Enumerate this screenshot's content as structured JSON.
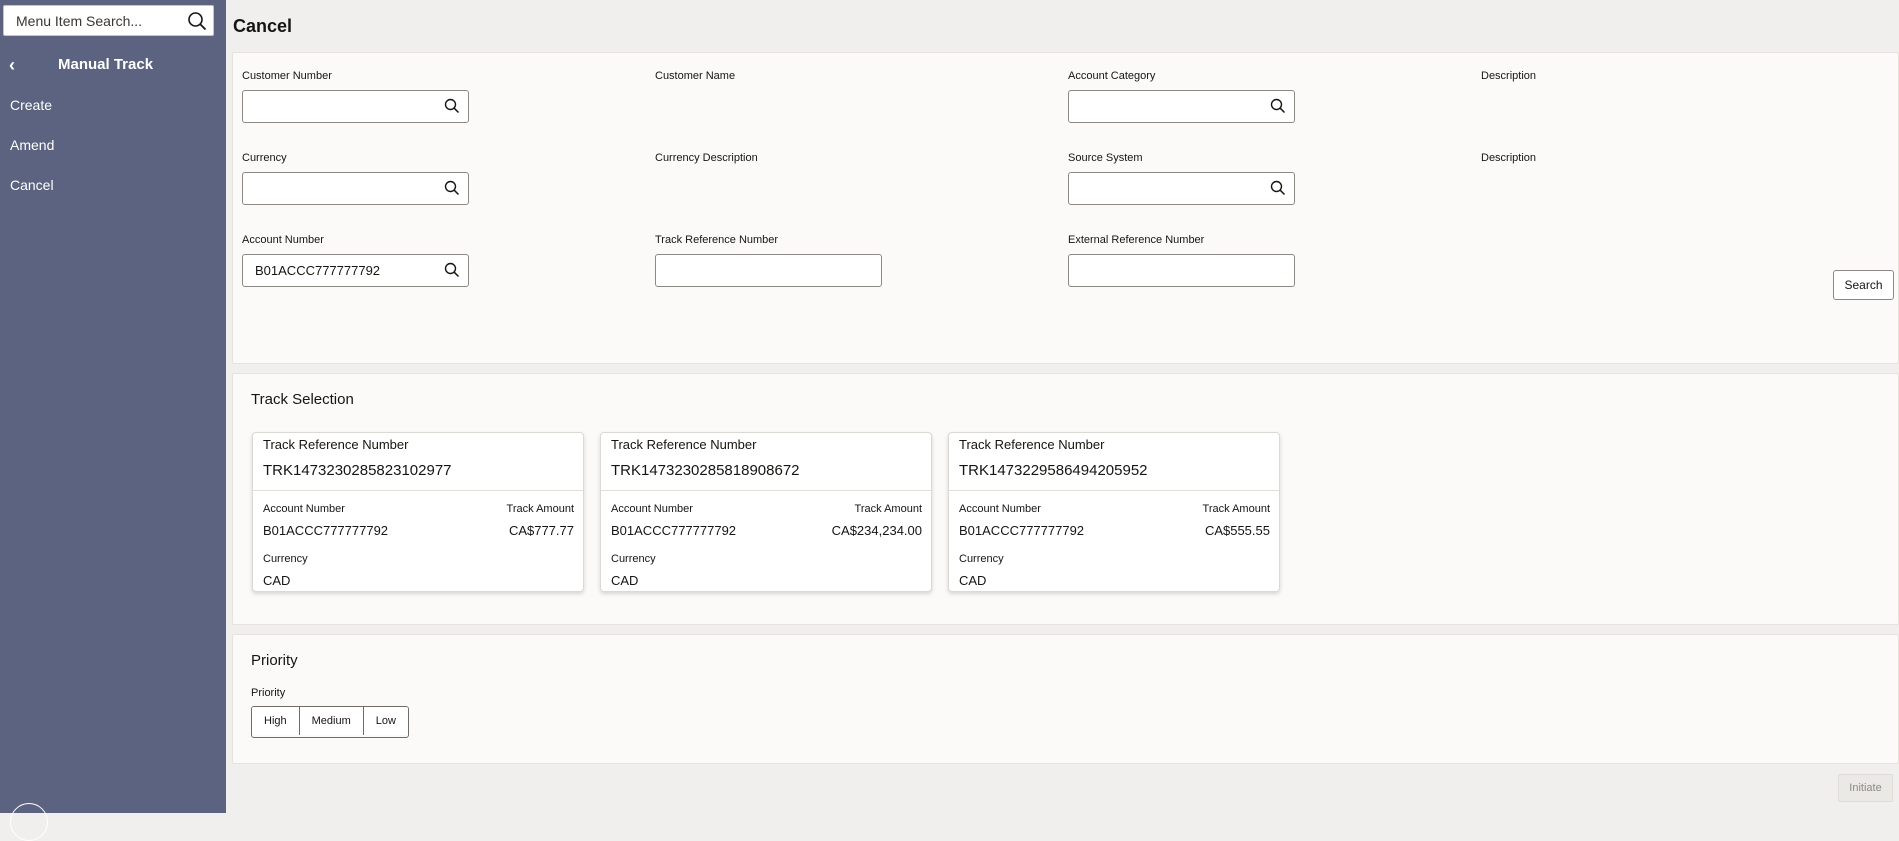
{
  "sidebar": {
    "search_placeholder": "Menu Item Search...",
    "title": "Manual Track",
    "items": [
      {
        "label": "Create"
      },
      {
        "label": "Amend"
      },
      {
        "label": "Cancel"
      }
    ]
  },
  "page": {
    "title": "Cancel"
  },
  "form": {
    "customer_number": {
      "label": "Customer Number",
      "value": ""
    },
    "customer_name": {
      "label": "Customer Name"
    },
    "account_category": {
      "label": "Account Category",
      "value": ""
    },
    "description1": {
      "label": "Description"
    },
    "currency": {
      "label": "Currency",
      "value": ""
    },
    "currency_description": {
      "label": "Currency Description"
    },
    "source_system": {
      "label": "Source System",
      "value": ""
    },
    "description2": {
      "label": "Description"
    },
    "account_number": {
      "label": "Account Number",
      "value": "B01ACCC777777792"
    },
    "track_reference_number": {
      "label": "Track Reference Number",
      "value": ""
    },
    "external_reference_number": {
      "label": "External Reference Number",
      "value": ""
    },
    "search_label": "Search"
  },
  "track_selection": {
    "title": "Track Selection",
    "cards": [
      {
        "ref_label": "Track Reference Number",
        "ref": "TRK1473230285823102977",
        "account_label": "Account Number",
        "account": "B01ACCC777777792",
        "amount_label": "Track Amount",
        "amount": "CA$777.77",
        "currency_label": "Currency",
        "currency": "CAD"
      },
      {
        "ref_label": "Track Reference Number",
        "ref": "TRK1473230285818908672",
        "account_label": "Account Number",
        "account": "B01ACCC777777792",
        "amount_label": "Track Amount",
        "amount": "CA$234,234.00",
        "currency_label": "Currency",
        "currency": "CAD"
      },
      {
        "ref_label": "Track Reference Number",
        "ref": "TRK1473229586494205952",
        "account_label": "Account Number",
        "account": "B01ACCC777777792",
        "amount_label": "Track Amount",
        "amount": "CA$555.55",
        "currency_label": "Currency",
        "currency": "CAD"
      }
    ]
  },
  "priority": {
    "title": "Priority",
    "label": "Priority",
    "options": [
      "High",
      "Medium",
      "Low"
    ]
  },
  "footer": {
    "initiate_label": "Initiate"
  },
  "colors": {
    "sidebar_bg": "#5b6380",
    "page_bg": "#f1efed",
    "panel_bg": "#fbfaf9"
  }
}
